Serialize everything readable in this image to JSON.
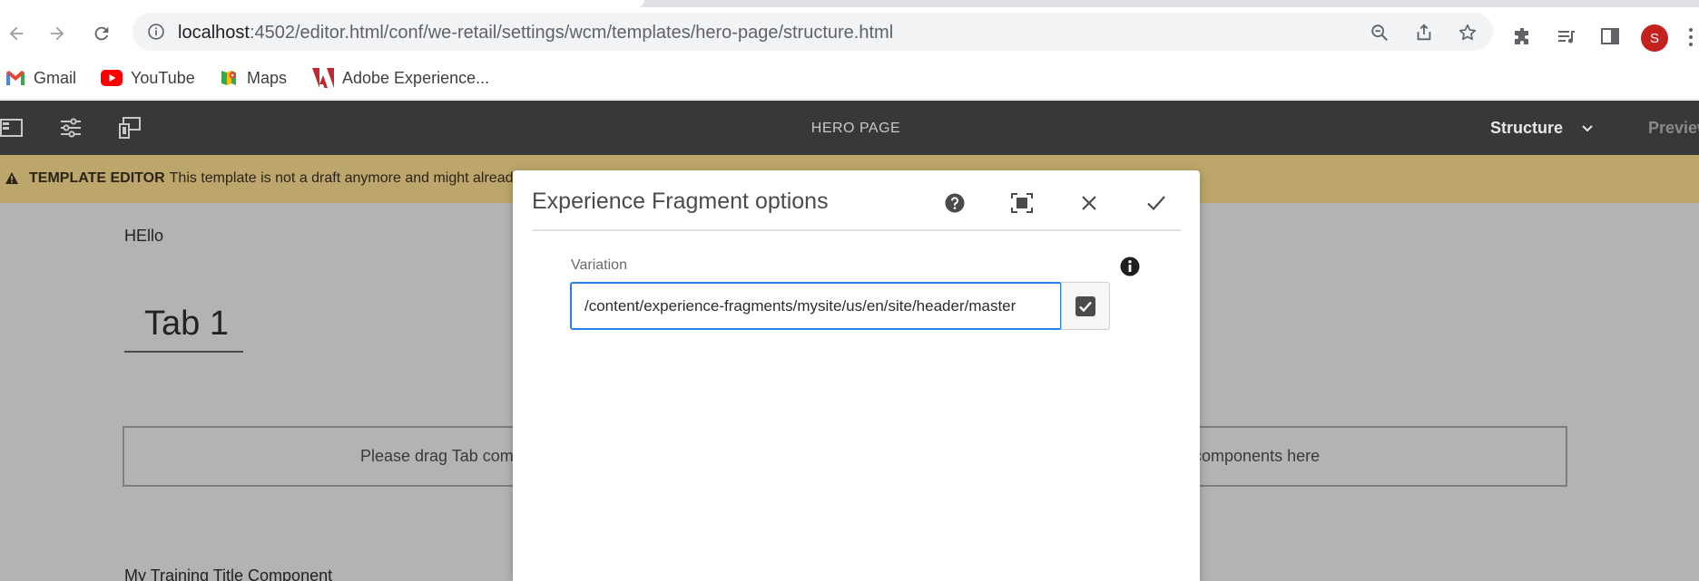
{
  "browser": {
    "url_host": "localhost",
    "url_path": ":4502/editor.html/conf/we-retail/settings/wcm/templates/hero-page/structure.html",
    "avatar_letter": "S",
    "bookmarks": [
      {
        "label": "Gmail",
        "icon": "gmail-icon"
      },
      {
        "label": "YouTube",
        "icon": "youtube-icon"
      },
      {
        "label": "Maps",
        "icon": "maps-icon"
      },
      {
        "label": "Adobe Experience...",
        "icon": "adobe-icon"
      }
    ]
  },
  "editor": {
    "page_title": "HERO PAGE",
    "mode": "Structure",
    "preview": "Preview",
    "alert_label": "TEMPLATE EDITOR",
    "alert_text": "This template is not a draft anymore and might already"
  },
  "canvas": {
    "hello_text": "HEllo",
    "tab_label": "Tab 1",
    "drop_left": "Please drag Tab compo",
    "drop_right": "o components here",
    "training_title": "My Training Title Component"
  },
  "dialog": {
    "title": "Experience Fragment options",
    "field_label": "Variation",
    "field_value": "/content/experience-fragments/mysite/us/en/site/header/master"
  },
  "colors": {
    "aem_toolbar": "#383838",
    "alert": "#bca66b",
    "canvas": "#b3b3b3",
    "focus": "#2680eb",
    "avatar": "#c5221f"
  }
}
